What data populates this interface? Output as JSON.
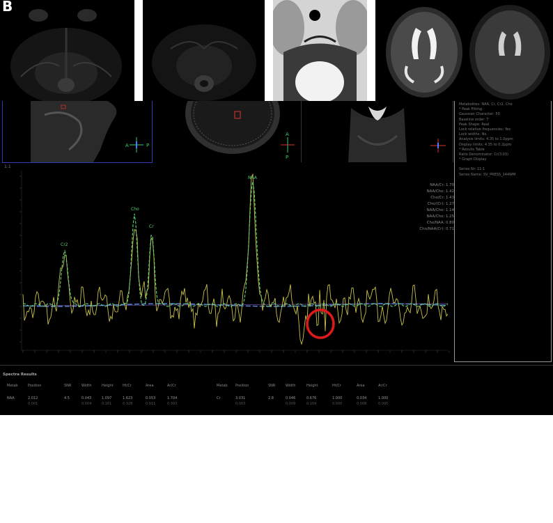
{
  "panel_label": "B",
  "viewport": {
    "orientation_labels": [
      "A",
      "P",
      "A",
      "P"
    ]
  },
  "info_panel": {
    "lines": [
      "Metabolites: NAA, Cr, Cr2, Cho",
      "* Peak Fitting",
      "  Gaussian Character: 50",
      "  Baseline order: 7",
      "  Peak Shape: Real",
      "  Lock relative frequencies: Yes",
      "  Lock widths: No",
      "  Analysis limits: 4.35 to 1.0ppm",
      "  Display limits: 4.35 to 0.2ppm",
      "* Results Table",
      "  Ratio Denominator: Cr(3.03)",
      "* Graph Display",
      "",
      "Series Nr: 11:1",
      "Series Name: SV_PRESS_144WM"
    ]
  },
  "spectrum": {
    "series_label": "1:1",
    "peak_labels": [
      "Cr2",
      "Cho",
      "Cr",
      "NAA"
    ],
    "ratios": [
      "NAA/Cr: 1.70",
      "NAA/Cho: 1.42",
      "Cho/Cr: 1.43",
      "Cho/(Cr): 1.27",
      "NAA/Cho: 1.14",
      "NAA/Cho: 1.25",
      "Cho/NAA: 0.80",
      "Cho/NAA(Cr): 0.71"
    ]
  },
  "results": {
    "title": "Spectra Results",
    "headers": [
      "Metab",
      "Position",
      "SNR",
      "Width",
      "Height",
      "Ht/Cr",
      "Area",
      "Ar/Cr"
    ],
    "left_row": [
      "NAA",
      "2.012",
      "4.5",
      "0.043",
      "1.097",
      "1.623",
      "0.053",
      "1.704"
    ],
    "right_row": [
      "Cr",
      "3.031",
      "2.8",
      "0.046",
      "0.676",
      "1.000",
      "0.034",
      "1.000"
    ],
    "left_sub": [
      "",
      "0.001",
      "",
      "0.004",
      "0.161",
      "0.328",
      "0.011",
      "0.393"
    ],
    "right_sub": [
      "",
      "0.003",
      "",
      "0.009",
      "0.104",
      "0.000",
      "0.008",
      "0.000"
    ]
  },
  "colors": {
    "spectrum_trace": "#c9c24a",
    "fit_trace": "#5fd37a",
    "baseline": "#5b8ad6",
    "annotation_circle": "#e01a1a",
    "viewport_border": "#2c3db5"
  }
}
